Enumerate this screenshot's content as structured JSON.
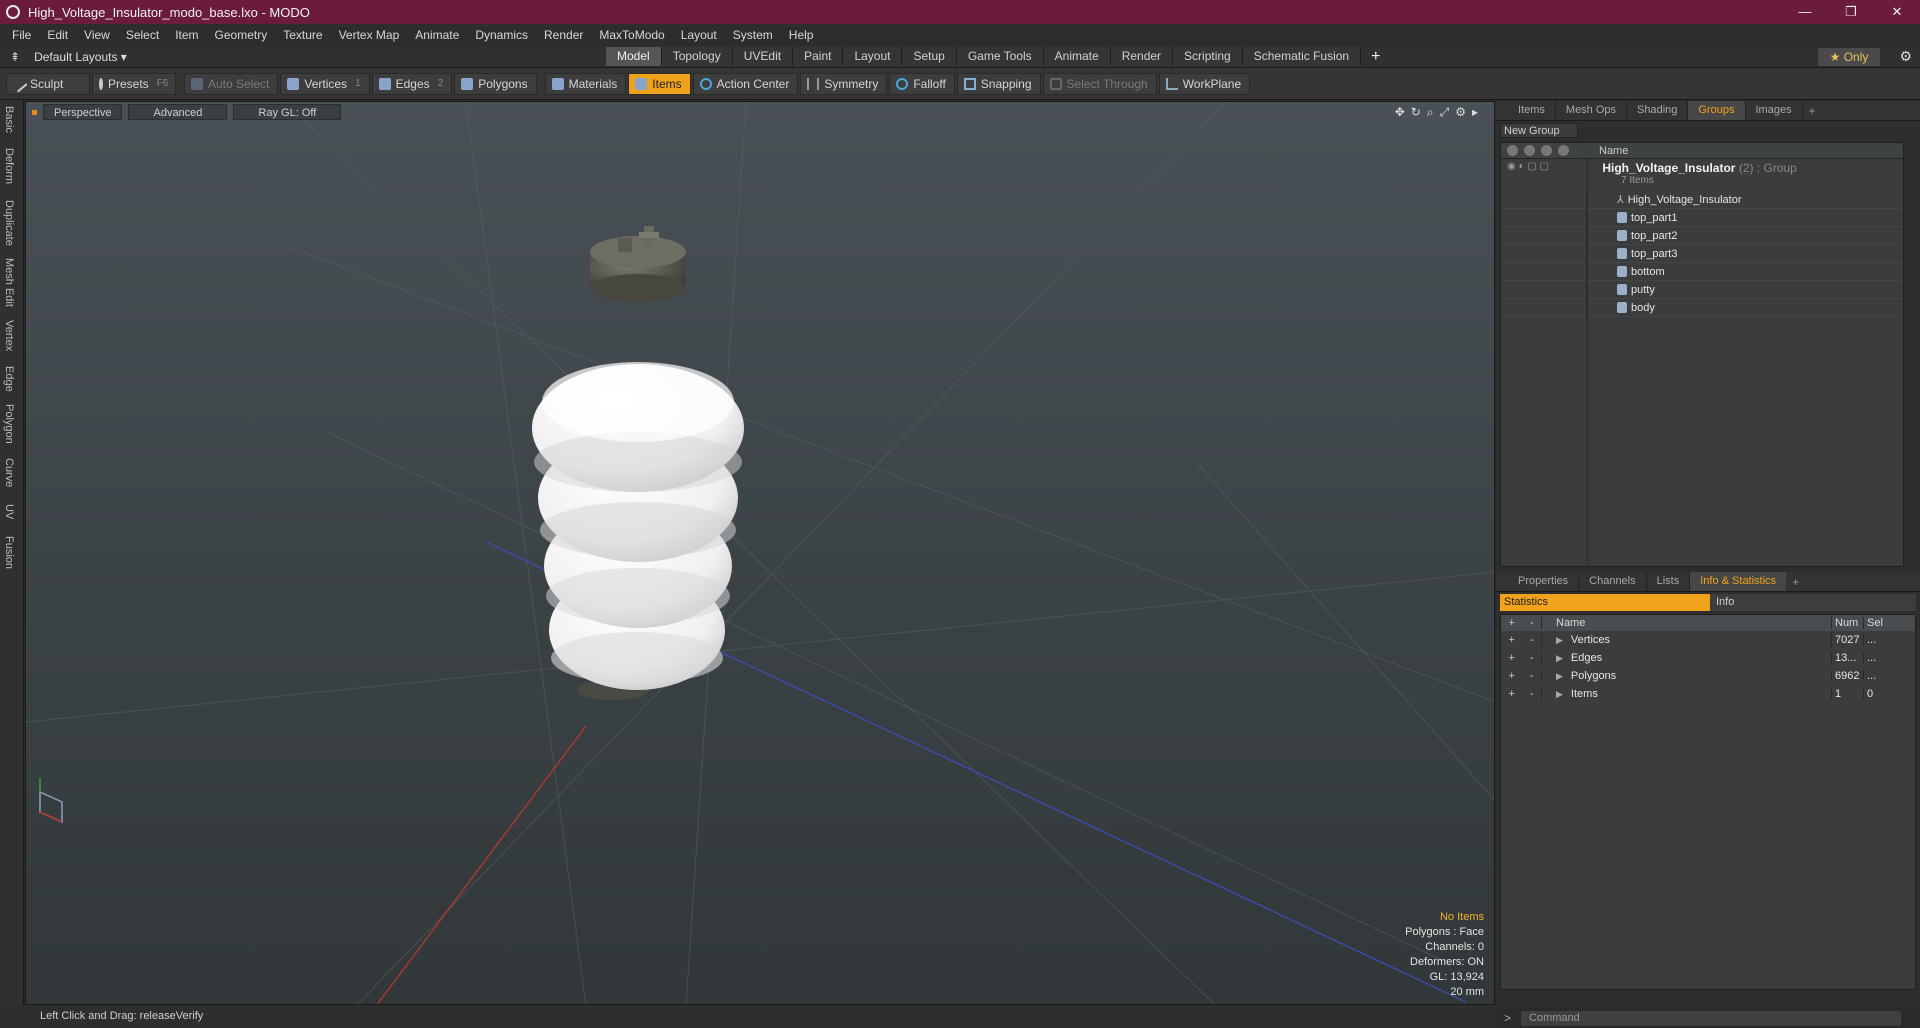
{
  "window": {
    "title": "High_Voltage_Insulator_modo_base.lxo - MODO",
    "controls": [
      "—",
      "❐",
      "✕"
    ]
  },
  "menu": [
    "File",
    "Edit",
    "View",
    "Select",
    "Item",
    "Geometry",
    "Texture",
    "Vertex Map",
    "Animate",
    "Dynamics",
    "Render",
    "MaxToModo",
    "Layout",
    "System",
    "Help"
  ],
  "layout_bar": {
    "layouts_label": "Default Layouts ▾",
    "tabs": [
      "Model",
      "Topology",
      "UVEdit",
      "Paint",
      "Layout",
      "Setup",
      "Game Tools",
      "Animate",
      "Render",
      "Scripting",
      "Schematic Fusion"
    ],
    "active_tab": "Model",
    "add": "+",
    "only": "★ Only"
  },
  "toolbar": {
    "sculpt": "Sculpt",
    "presets": "Presets",
    "presets_key": "F6",
    "auto_select": "Auto Select",
    "vertices": "Vertices",
    "vertices_key": "1",
    "edges": "Edges",
    "edges_key": "2",
    "polygons": "Polygons",
    "materials": "Materials",
    "items": "Items",
    "action_center": "Action Center",
    "symmetry": "Symmetry",
    "falloff": "Falloff",
    "snapping": "Snapping",
    "select_through": "Select Through",
    "workplane": "WorkPlane"
  },
  "left_tabs": [
    "Basic",
    "Deform",
    "Duplicate",
    "Mesh Edit",
    "Vertex",
    "Edge",
    "Polygon",
    "Curve",
    "UV",
    "Fusion"
  ],
  "viewport": {
    "view": "Perspective",
    "shading": "Advanced",
    "raygl": "Ray GL: Off",
    "info": {
      "no_items": "No Items",
      "polygons": "Polygons : Face",
      "channels": "Channels: 0",
      "deformers": "Deformers: ON",
      "gl": "GL: 13,924",
      "scale": "20 mm"
    }
  },
  "status": "Left Click and Drag:  releaseVerify",
  "groups_panel": {
    "tabs": [
      "Items",
      "Mesh Ops",
      "Shading",
      "Groups",
      "Images"
    ],
    "active_tab": "Groups",
    "new_group": "New Group",
    "column_name": "Name",
    "group_name": "High_Voltage_Insulator",
    "group_type": "(2) : Group",
    "group_count": "7 Items",
    "items": [
      "High_Voltage_Insulator",
      "top_part1",
      "top_part2",
      "top_part3",
      "bottom",
      "putty",
      "body"
    ]
  },
  "stats_panel": {
    "tabs": [
      "Properties",
      "Channels",
      "Lists",
      "Info & Statistics"
    ],
    "active_tab": "Info & Statistics",
    "sub_tabs": [
      "Statistics",
      "Info"
    ],
    "columns": [
      "Name",
      "Num",
      "Sel"
    ],
    "rows": [
      {
        "name": "Vertices",
        "num": "7027",
        "sel": "..."
      },
      {
        "name": "Edges",
        "num": "13...",
        "sel": "..."
      },
      {
        "name": "Polygons",
        "num": "6962",
        "sel": "..."
      },
      {
        "name": "Items",
        "num": "1",
        "sel": "0"
      }
    ]
  },
  "command_placeholder": "Command",
  "colors": {
    "accent": "#f0a21a",
    "titlebar": "#6b1b3c"
  }
}
